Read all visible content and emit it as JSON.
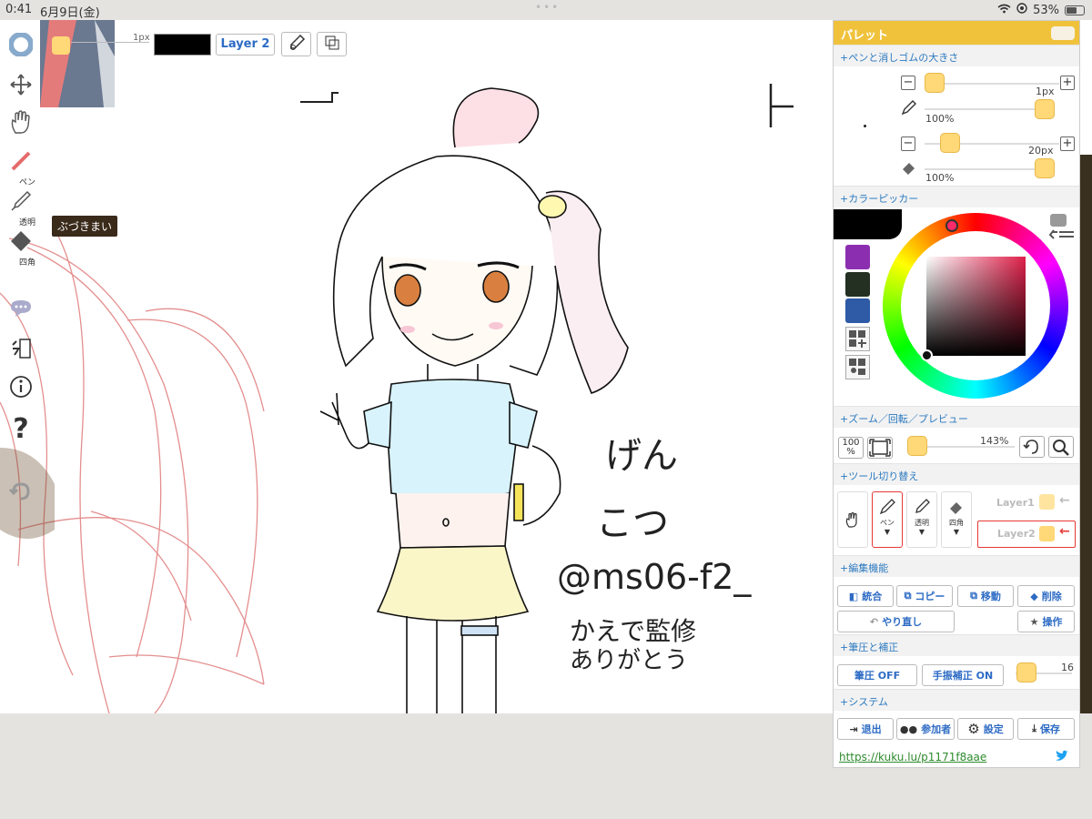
{
  "status": {
    "time": "0:41",
    "date": "6月9日(金)",
    "battery": "53%"
  },
  "left_toolbar": {
    "pen_label": "ペン",
    "transparent_label": "透明",
    "square_label": "四角",
    "tooltip": "ぶづきまい"
  },
  "topbar": {
    "size_label": "1px",
    "layer_button": "Layer 2"
  },
  "palette": {
    "title": "パレット",
    "sections": {
      "pen_eraser_size": "+ペンと消しゴムの大きさ",
      "color_picker": "+カラーピッカー",
      "zoom": "+ズーム／回転／プレビュー",
      "tool_switch": "+ツール切り替え",
      "edit": "+編集機能",
      "pressure": "+筆圧と補正",
      "system": "+システム"
    },
    "pen_size": "1px",
    "pen_opacity": "100%",
    "eraser_size": "20px",
    "eraser_opacity": "100%",
    "swatch_colors": [
      "#8b2fb0",
      "#233022",
      "#2e5aa6"
    ],
    "zoom_button": "100\n%",
    "zoom_value": "143%",
    "tools": {
      "pen": "ペン",
      "transparent": "透明",
      "square": "四角"
    },
    "layers": [
      "Layer1",
      "Layer2"
    ],
    "edit_buttons": {
      "merge": "統合",
      "copy": "コピー",
      "move": "移動",
      "delete": "削除",
      "redo": "やり直し",
      "operate": "操作"
    },
    "pressure_buttons": {
      "pressure": "筆圧 OFF",
      "stabilizer": "手振補正 ON",
      "stabilizer_value": "16"
    },
    "system_buttons": {
      "exit": "退出",
      "participants": "参加者",
      "settings": "設定",
      "save": "保存"
    },
    "url": "https://kuku.lu/p1171f8aae"
  },
  "canvas_text": {
    "line1": "げん",
    "line2": "こつ",
    "handle": "@ms06-f2_",
    "note1": "かえで監修",
    "note2": "ありがとう"
  },
  "colors": {
    "accent": "#f0c23c",
    "knob": "#ffd877",
    "link_blue": "#2d6bc4",
    "active_red": "#e53935"
  }
}
